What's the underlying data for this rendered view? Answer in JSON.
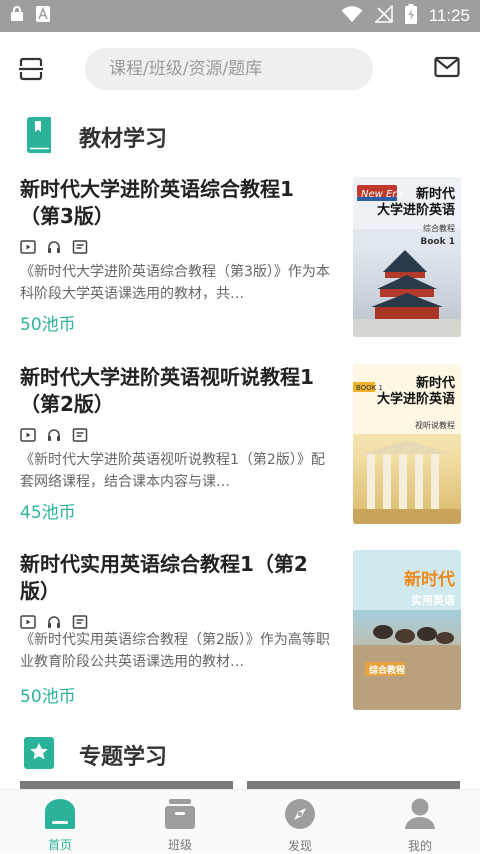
{
  "status_bar": {
    "time": "11:25"
  },
  "header": {
    "search": {
      "placeholder": "课程/班级/资源/题库"
    }
  },
  "sections": [
    {
      "title": "教材学习"
    },
    {
      "title": "专题学习"
    }
  ],
  "books": [
    {
      "title": "新时代大学进阶英语综合教程1（第3版）",
      "description": "《新时代大学进阶英语综合教程（第3版）》作为本科阶段大学英语课选用的教材，共…",
      "price": "50池币",
      "cover": {
        "heading": "新时代\n大学进阶英语",
        "sub": "综合教程",
        "label": "Book 1",
        "brand": "New Era"
      }
    },
    {
      "title": "新时代大学进阶英语视听说教程1（第2版）",
      "description": "《新时代大学进阶英语视听说教程1（第2版）》配套网络课程，结合课本内容与课…",
      "price": "45池币",
      "cover": {
        "heading": "新时代\n大学进阶英语",
        "sub": "视听说教程",
        "label": "BOOK 1"
      }
    },
    {
      "title": "新时代实用英语综合教程1（第2版）",
      "description": "《新时代实用英语综合教程（第2版）》作为高等职业教育阶段公共英语课选用的教材…",
      "price": "50池币",
      "cover": {
        "heading": "新时代",
        "sub": "实用英语",
        "label": "综合教程"
      }
    }
  ],
  "tabs": [
    {
      "label": "首页",
      "active": true
    },
    {
      "label": "班级",
      "active": false
    },
    {
      "label": "发现",
      "active": false
    },
    {
      "label": "我的",
      "active": false
    }
  ],
  "colors": {
    "accent": "#2bb39a",
    "status_bar": "#9e9e9e",
    "inactive_icon": "#9e9e9e"
  }
}
